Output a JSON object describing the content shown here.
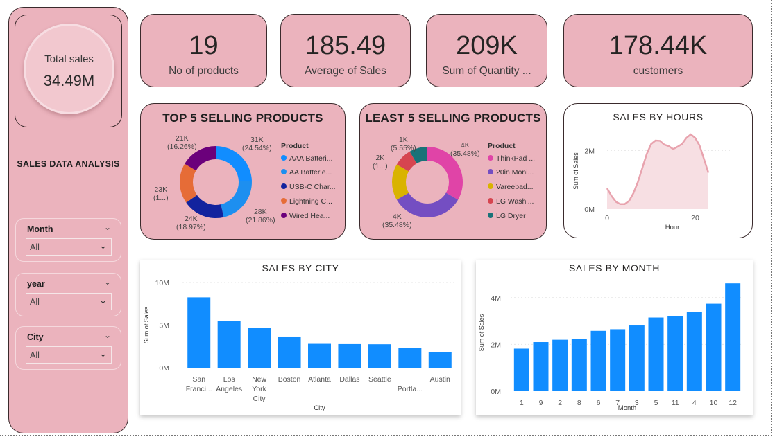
{
  "sidebar": {
    "total_sales_label": "Total sales",
    "total_sales_value": "34.49M",
    "title": "SALES DATA ANALYSIS",
    "slicers": [
      {
        "label": "Month",
        "value": "All"
      },
      {
        "label": "year",
        "value": "All"
      },
      {
        "label": "City",
        "value": "All"
      }
    ]
  },
  "kpis": [
    {
      "value": "19",
      "label": "No of products"
    },
    {
      "value": "185.49",
      "label": "Average of Sales"
    },
    {
      "value": "209K",
      "label": "Sum of Quantity ..."
    },
    {
      "value": "178.44K",
      "label": "customers"
    }
  ],
  "top5": {
    "title": "TOP 5 SELLING PRODUCTS",
    "legend_title": "Product",
    "legend": [
      "AAA Batteri...",
      "AA Batterie...",
      "USB-C Char...",
      "Lightning C...",
      "Wired Hea..."
    ],
    "labels": [
      {
        "value": "31K",
        "pct": "(24.54%)"
      },
      {
        "value": "28K",
        "pct": "(21.86%)"
      },
      {
        "value": "24K",
        "pct": "(18.97%)"
      },
      {
        "value": "23K",
        "pct": "(1...)"
      },
      {
        "value": "21K",
        "pct": "(16.26%)"
      }
    ]
  },
  "least5": {
    "title": "LEAST 5 SELLING PRODUCTS",
    "legend_title": "Product",
    "legend": [
      "ThinkPad ...",
      "20in Moni...",
      "Vareebad...",
      "LG Washi...",
      "LG Dryer"
    ],
    "labels": [
      {
        "value": "4K",
        "pct": "(35.48%)"
      },
      {
        "value": "4K",
        "pct": "(35.48%)"
      },
      {
        "value": "2K",
        "pct": "(1...)"
      },
      {
        "value": "1K",
        "pct": "(5.55%)"
      }
    ]
  },
  "hours": {
    "title": "SALES BY HOURS",
    "ylabel": "Sum of Sales",
    "xlabel": "Hour",
    "yticks": [
      "2M",
      "0M"
    ],
    "xticks": [
      "0",
      "20"
    ]
  },
  "city": {
    "title": "SALES BY CITY",
    "ylabel": "Sum of Sales",
    "xlabel": "City",
    "yticks": [
      "10M",
      "5M",
      "0M"
    ],
    "categories": [
      [
        "San",
        "Franci..."
      ],
      [
        "Los",
        "Angeles"
      ],
      [
        "New",
        "York",
        "City"
      ],
      [
        "Boston"
      ],
      [
        "Atlanta"
      ],
      [
        "Dallas"
      ],
      [
        "Seattle"
      ],
      [
        "",
        "Portla..."
      ],
      [
        "Austin"
      ]
    ]
  },
  "month": {
    "title": "SALES BY MONTH",
    "ylabel": "Sum of Sales",
    "xlabel": "Month",
    "yticks": [
      "4M",
      "2M",
      "0M"
    ],
    "categories": [
      "1",
      "9",
      "2",
      "8",
      "6",
      "7",
      "3",
      "5",
      "11",
      "4",
      "10",
      "12"
    ]
  },
  "colors": {
    "pink_bg": "#ebb3bd",
    "bar_blue": "#118dff",
    "top5_slices": [
      "#118dff",
      "#1d8ff0",
      "#12239e",
      "#e66c37",
      "#6b007b"
    ],
    "least5_slices": [
      "#e044a7",
      "#744ec2",
      "#d9b300",
      "#d64550",
      "#197278"
    ],
    "hours_line": "#e8a3ae"
  },
  "chart_data": [
    {
      "type": "pie",
      "title": "TOP 5 SELLING PRODUCTS",
      "categories": [
        "AAA Batteri...",
        "AA Batterie...",
        "USB-C Char...",
        "Lightning C...",
        "Wired Hea..."
      ],
      "values": [
        31,
        28,
        24,
        23,
        21
      ],
      "percent": [
        24.54,
        21.86,
        18.97,
        18.37,
        16.26
      ],
      "unit": "K"
    },
    {
      "type": "pie",
      "title": "LEAST 5 SELLING PRODUCTS",
      "categories": [
        "ThinkPad ...",
        "20in Moni...",
        "Vareebad...",
        "LG Washi...",
        "LG Dryer"
      ],
      "values": [
        4,
        4,
        2,
        1,
        1
      ],
      "percent": [
        35.48,
        35.48,
        18.0,
        5.55,
        5.49
      ],
      "unit": "K"
    },
    {
      "type": "area",
      "title": "SALES BY HOURS",
      "xlabel": "Hour",
      "ylabel": "Sum of Sales",
      "x": [
        0,
        1,
        2,
        3,
        4,
        5,
        6,
        7,
        8,
        9,
        10,
        11,
        12,
        13,
        14,
        15,
        16,
        17,
        18,
        19,
        20,
        21,
        22,
        23
      ],
      "values": [
        0.71,
        0.45,
        0.25,
        0.17,
        0.17,
        0.28,
        0.55,
        0.93,
        1.4,
        1.88,
        2.22,
        2.34,
        2.33,
        2.2,
        2.15,
        2.05,
        2.13,
        2.22,
        2.43,
        2.55,
        2.43,
        2.17,
        1.71,
        1.24
      ],
      "ylim": [
        0,
        2.6
      ],
      "unit": "M"
    },
    {
      "type": "bar",
      "title": "SALES BY CITY",
      "xlabel": "City",
      "ylabel": "Sum of Sales",
      "categories": [
        "San Franci...",
        "Los Angeles",
        "New York City",
        "Boston",
        "Atlanta",
        "Dallas",
        "Seattle",
        "Portla...",
        "Austin"
      ],
      "values": [
        8.26,
        5.45,
        4.66,
        3.66,
        2.8,
        2.77,
        2.75,
        2.32,
        1.82
      ],
      "ylim": [
        0,
        10
      ],
      "unit": "M"
    },
    {
      "type": "bar",
      "title": "SALES BY MONTH",
      "xlabel": "Month",
      "ylabel": "Sum of Sales",
      "categories": [
        "1",
        "9",
        "2",
        "8",
        "6",
        "7",
        "3",
        "5",
        "11",
        "4",
        "10",
        "12"
      ],
      "values": [
        1.82,
        2.1,
        2.2,
        2.24,
        2.58,
        2.65,
        2.81,
        3.15,
        3.2,
        3.39,
        3.74,
        4.61
      ],
      "ylim": [
        0,
        5
      ],
      "unit": "M"
    }
  ]
}
